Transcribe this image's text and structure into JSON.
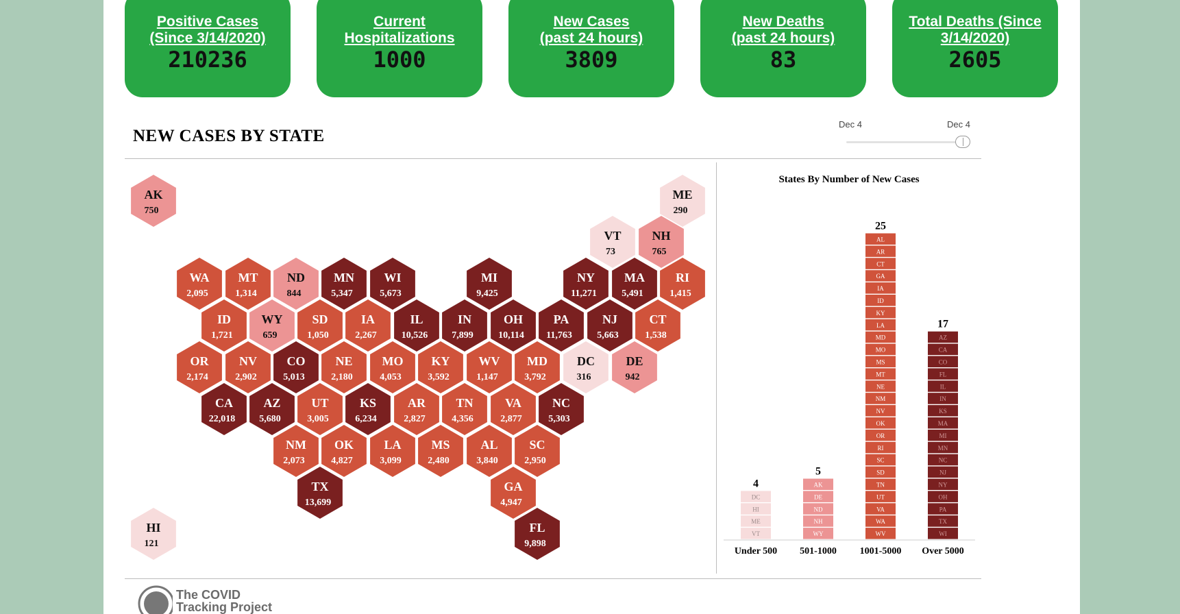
{
  "stat_cards": [
    {
      "label": "Positive Cases\n(Since 3/14/2020)",
      "value": "210236"
    },
    {
      "label": "Current\nHospitalizations",
      "value": "1000"
    },
    {
      "label": "New Cases\n(past 24 hours)",
      "value": "3809"
    },
    {
      "label": "New Deaths\n(past 24 hours)",
      "value": "83"
    },
    {
      "label": "Total Deaths (Since\n3/14/2020)",
      "value": "2605"
    }
  ],
  "colors": {
    "card_green": "#28a745",
    "under_500": "#f7dcdc",
    "range_501_1000": "#ec9494",
    "range_1001_5000": "#d0533b",
    "over_5000": "#7a2020"
  },
  "section": {
    "title": "NEW CASES BY STATE"
  },
  "date_slider": {
    "start_label": "Dec 4",
    "end_label": "Dec 4"
  },
  "footer": {
    "logo_text": "The COVID\nTracking Project"
  },
  "chart_data": [
    {
      "type": "hex-tile-map",
      "states": [
        {
          "abbr": "AK",
          "value": "750"
        },
        {
          "abbr": "ME",
          "value": "290"
        },
        {
          "abbr": "VT",
          "value": "73"
        },
        {
          "abbr": "NH",
          "value": "765"
        },
        {
          "abbr": "WA",
          "value": "2,095"
        },
        {
          "abbr": "MT",
          "value": "1,314"
        },
        {
          "abbr": "ND",
          "value": "844"
        },
        {
          "abbr": "MN",
          "value": "5,347"
        },
        {
          "abbr": "WI",
          "value": "5,673"
        },
        {
          "abbr": "MI",
          "value": "9,425"
        },
        {
          "abbr": "NY",
          "value": "11,271"
        },
        {
          "abbr": "MA",
          "value": "5,491"
        },
        {
          "abbr": "RI",
          "value": "1,415"
        },
        {
          "abbr": "ID",
          "value": "1,721"
        },
        {
          "abbr": "WY",
          "value": "659"
        },
        {
          "abbr": "SD",
          "value": "1,050"
        },
        {
          "abbr": "IA",
          "value": "2,267"
        },
        {
          "abbr": "IL",
          "value": "10,526"
        },
        {
          "abbr": "IN",
          "value": "7,899"
        },
        {
          "abbr": "OH",
          "value": "10,114"
        },
        {
          "abbr": "PA",
          "value": "11,763"
        },
        {
          "abbr": "NJ",
          "value": "5,663"
        },
        {
          "abbr": "CT",
          "value": "1,538"
        },
        {
          "abbr": "OR",
          "value": "2,174"
        },
        {
          "abbr": "NV",
          "value": "2,902"
        },
        {
          "abbr": "CO",
          "value": "5,013"
        },
        {
          "abbr": "NE",
          "value": "2,180"
        },
        {
          "abbr": "MO",
          "value": "4,053"
        },
        {
          "abbr": "KY",
          "value": "3,592"
        },
        {
          "abbr": "WV",
          "value": "1,147"
        },
        {
          "abbr": "MD",
          "value": "3,792"
        },
        {
          "abbr": "DC",
          "value": "316"
        },
        {
          "abbr": "DE",
          "value": "942"
        },
        {
          "abbr": "CA",
          "value": "22,018"
        },
        {
          "abbr": "AZ",
          "value": "5,680"
        },
        {
          "abbr": "UT",
          "value": "3,005"
        },
        {
          "abbr": "KS",
          "value": "6,234"
        },
        {
          "abbr": "AR",
          "value": "2,827"
        },
        {
          "abbr": "TN",
          "value": "4,356"
        },
        {
          "abbr": "VA",
          "value": "2,877"
        },
        {
          "abbr": "NC",
          "value": "5,303"
        },
        {
          "abbr": "NM",
          "value": "2,073"
        },
        {
          "abbr": "OK",
          "value": "4,827"
        },
        {
          "abbr": "LA",
          "value": "3,099"
        },
        {
          "abbr": "MS",
          "value": "2,480"
        },
        {
          "abbr": "AL",
          "value": "3,840"
        },
        {
          "abbr": "SC",
          "value": "2,950"
        },
        {
          "abbr": "TX",
          "value": "13,699"
        },
        {
          "abbr": "GA",
          "value": "4,947"
        },
        {
          "abbr": "HI",
          "value": "121"
        },
        {
          "abbr": "FL",
          "value": "9,898"
        }
      ]
    },
    {
      "type": "bar",
      "title": "States By Number of New Cases",
      "categories": [
        "Under 500",
        "501-1000",
        "1001-5000",
        "Over 5000"
      ],
      "values": [
        4,
        5,
        25,
        17
      ],
      "members": [
        [
          "DC",
          "HI",
          "ME",
          "VT"
        ],
        [
          "AK",
          "DE",
          "ND",
          "NH",
          "WY"
        ],
        [
          "AL",
          "AR",
          "CT",
          "GA",
          "IA",
          "ID",
          "KY",
          "LA",
          "MD",
          "MO",
          "MS",
          "MT",
          "NE",
          "NM",
          "NV",
          "OK",
          "OR",
          "RI",
          "SC",
          "SD",
          "TN",
          "UT",
          "VA",
          "WA",
          "WV"
        ],
        [
          "AZ",
          "CA",
          "CO",
          "FL",
          "IL",
          "IN",
          "KS",
          "MA",
          "MI",
          "MN",
          "NC",
          "NJ",
          "NY",
          "OH",
          "PA",
          "TX",
          "WI"
        ]
      ]
    }
  ]
}
